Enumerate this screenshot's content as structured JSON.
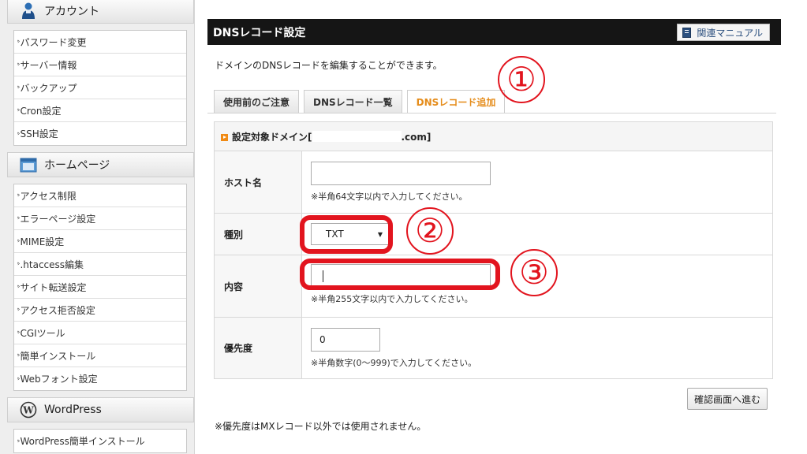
{
  "sidebar": {
    "sections": [
      {
        "title": "アカウント",
        "icon": "account-person-icon",
        "items": [
          "パスワード変更",
          "サーバー情報",
          "バックアップ",
          "Cron設定",
          "SSH設定"
        ]
      },
      {
        "title": "ホームページ",
        "icon": "homepage-window-icon",
        "items": [
          "アクセス制限",
          "エラーページ設定",
          "MIME設定",
          ".htaccess編集",
          "サイト転送設定",
          "アクセス拒否設定",
          "CGIツール",
          "簡単インストール",
          "Webフォント設定"
        ]
      },
      {
        "title": "WordPress",
        "icon": "wordpress-icon",
        "items": [
          "WordPress簡単インストール"
        ]
      }
    ]
  },
  "page": {
    "title": "DNSレコード設定",
    "manual_label": "関連マニュアル",
    "intro": "ドメインのDNSレコードを編集することができます。",
    "tabs": [
      "使用前のご注意",
      "DNSレコード一覧",
      "DNSレコード追加"
    ],
    "active_tab": "DNSレコード追加"
  },
  "form": {
    "domain_label": "設定対象ドメイン[",
    "domain_suffix": ".com]",
    "host_label": "ホスト名",
    "host_value": "",
    "host_note": "※半角64文字以内で入力してください。",
    "type_label": "種別",
    "type_value": "TXT",
    "content_label": "内容",
    "content_value": "",
    "content_note": "※半角255文字以内で入力してください。",
    "priority_label": "優先度",
    "priority_value": "0",
    "priority_note": "※半角数字(0～999)で入力してください。",
    "confirm_label": "確認画面へ進む",
    "footnote": "※優先度はMXレコード以外では使用されません。"
  },
  "annotations": {
    "step1": "①",
    "step2": "②",
    "step3": "③",
    "color": "#e2141e"
  }
}
